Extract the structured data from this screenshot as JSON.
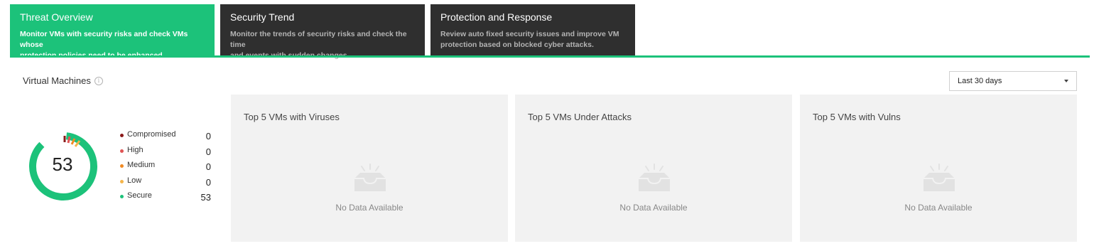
{
  "tabs": [
    {
      "title": "Threat Overview",
      "desc_line1": "Monitor VMs with security risks and check VMs whose",
      "desc_line2": "protection policies need to be enhanced."
    },
    {
      "title": "Security Trend",
      "desc_line1": "Monitor the trends of security risks and check the time",
      "desc_line2": "and events with sudden changes."
    },
    {
      "title": "Protection and Response",
      "desc_line1": "Review auto fixed security issues and improve VM",
      "desc_line2": "protection based on blocked cyber attacks."
    }
  ],
  "colors": {
    "accent": "#1cc27a",
    "tab_dark": "#2f2f2f",
    "compromised": "#8b1a1a",
    "high": "#e05555",
    "medium": "#f08a24",
    "low": "#f5b54a",
    "secure": "#1cc27a"
  },
  "section": {
    "title": "Virtual Machines",
    "info_icon": "info-icon"
  },
  "time_filter": {
    "selected": "Last 30 days"
  },
  "summary": {
    "total": "53",
    "legend": [
      {
        "label": "Compromised",
        "value": "0"
      },
      {
        "label": "High",
        "value": "0"
      },
      {
        "label": "Medium",
        "value": "0"
      },
      {
        "label": "Low",
        "value": "0"
      },
      {
        "label": "Secure",
        "value": "53"
      }
    ]
  },
  "cards": [
    {
      "title": "Top 5 VMs with Viruses",
      "empty": "No Data Available"
    },
    {
      "title": "Top 5 VMs Under Attacks",
      "empty": "No Data Available"
    },
    {
      "title": "Top 5 VMs with Vulns",
      "empty": "No Data Available"
    }
  ]
}
